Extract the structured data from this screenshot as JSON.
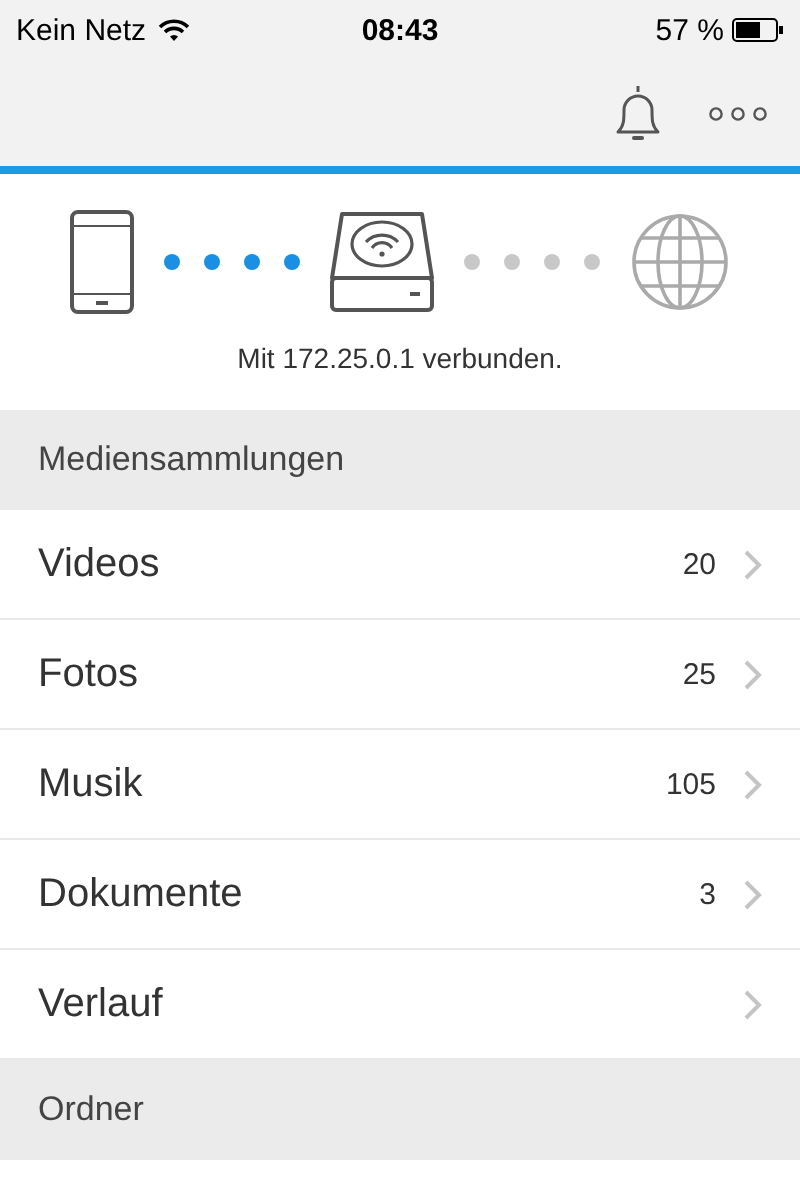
{
  "status_bar": {
    "carrier": "Kein Netz",
    "time": "08:43",
    "battery": "57 %"
  },
  "connection": {
    "links": [
      {
        "connected": true
      },
      {
        "connected": false
      }
    ],
    "message": "Mit 172.25.0.1 verbunden."
  },
  "sections": [
    {
      "title": "Mediensammlungen",
      "items": [
        {
          "label": "Videos",
          "count": "20"
        },
        {
          "label": "Fotos",
          "count": "25"
        },
        {
          "label": "Musik",
          "count": "105"
        },
        {
          "label": "Dokumente",
          "count": "3"
        },
        {
          "label": "Verlauf"
        }
      ]
    },
    {
      "title": "Ordner"
    }
  ]
}
